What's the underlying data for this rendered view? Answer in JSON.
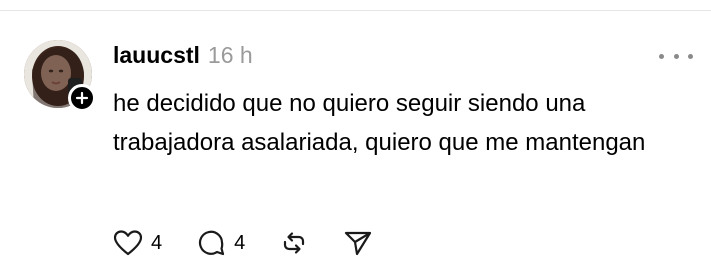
{
  "post": {
    "username": "lauucstl",
    "time": "16 h",
    "text": "he decidido que no quiero seguir siendo una trabajadora asalariada, quiero que me mantengan",
    "likes": "4",
    "replies": "4"
  },
  "icons": {
    "follow": "plus-icon",
    "more": "more-horizontal-icon",
    "like": "heart-icon",
    "reply": "comment-icon",
    "repost": "repost-icon",
    "share": "send-icon"
  }
}
